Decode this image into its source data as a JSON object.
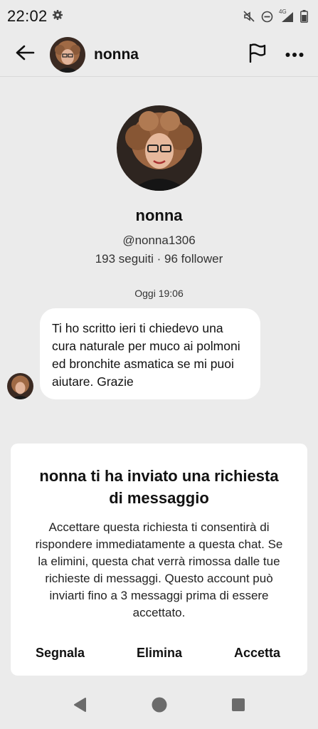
{
  "status_bar": {
    "time": "22:02",
    "network_label": "4G",
    "icons": [
      "gear-icon",
      "mute-icon",
      "dnd-icon",
      "signal-icon",
      "battery-icon"
    ]
  },
  "header": {
    "name": "nonna",
    "icons": [
      "back-arrow-icon",
      "flag-icon",
      "more-icon"
    ]
  },
  "profile": {
    "name": "nonna",
    "handle": "@nonna1306",
    "stats": "193 seguiti · 96 follower"
  },
  "chat": {
    "timestamp": "Oggi 19:06",
    "message": "Ti ho scritto ieri ti chiedevo una cura naturale per muco ai polmoni ed bronchite asmatica se mi puoi aiutare. Grazie"
  },
  "request_card": {
    "title": "nonna ti ha inviato una richiesta di messaggio",
    "body": "Accettare questa richiesta ti consentirà di rispondere immediatamente a questa chat. Se la elimini, questa chat verrà rimossa dalle tue richieste di messaggi. Questo account può inviarti fino a 3 messaggi prima di essere accettato.",
    "report_label": "Segnala",
    "delete_label": "Elimina",
    "accept_label": "Accetta"
  },
  "nav_bar": {
    "icons": [
      "back-triangle-icon",
      "home-circle-icon",
      "recents-square-icon"
    ]
  },
  "colors": {
    "background": "#ebebeb",
    "card": "#ffffff",
    "text": "#111111"
  }
}
